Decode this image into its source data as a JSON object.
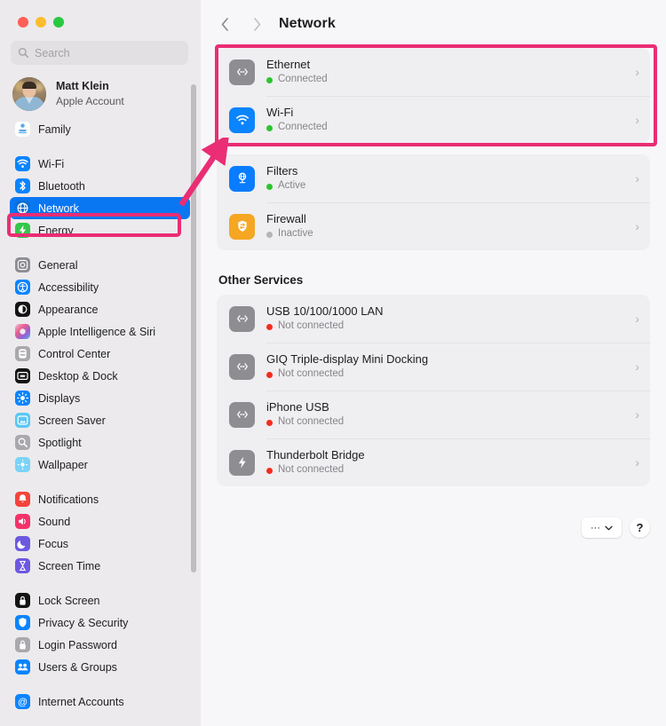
{
  "window": {
    "traffic_lights": [
      {
        "name": "close",
        "color": "#ff5f57"
      },
      {
        "name": "minimize",
        "color": "#febc2e"
      },
      {
        "name": "maximize",
        "color": "#28c840"
      }
    ]
  },
  "search": {
    "value": "",
    "placeholder": "Search"
  },
  "account": {
    "name": "Matt Klein",
    "subtitle": "Apple Account"
  },
  "sidebar": {
    "groups": [
      {
        "items": [
          {
            "label": "Family",
            "icon": "family-icon"
          }
        ]
      },
      {
        "items": [
          {
            "label": "Wi-Fi",
            "icon": "wifi-icon"
          },
          {
            "label": "Bluetooth",
            "icon": "bluetooth-icon"
          },
          {
            "label": "Network",
            "icon": "network-icon",
            "selected": true
          },
          {
            "label": "Energy",
            "icon": "energy-icon"
          }
        ]
      },
      {
        "items": [
          {
            "label": "General",
            "icon": "general-icon"
          },
          {
            "label": "Accessibility",
            "icon": "accessibility-icon"
          },
          {
            "label": "Appearance",
            "icon": "appearance-icon"
          },
          {
            "label": "Apple Intelligence & Siri",
            "icon": "apple-intelligence-icon"
          },
          {
            "label": "Control Center",
            "icon": "control-center-icon"
          },
          {
            "label": "Desktop & Dock",
            "icon": "desktop-dock-icon"
          },
          {
            "label": "Displays",
            "icon": "displays-icon"
          },
          {
            "label": "Screen Saver",
            "icon": "screen-saver-icon"
          },
          {
            "label": "Spotlight",
            "icon": "spotlight-icon"
          },
          {
            "label": "Wallpaper",
            "icon": "wallpaper-icon"
          }
        ]
      },
      {
        "items": [
          {
            "label": "Notifications",
            "icon": "notifications-icon"
          },
          {
            "label": "Sound",
            "icon": "sound-icon"
          },
          {
            "label": "Focus",
            "icon": "focus-icon"
          },
          {
            "label": "Screen Time",
            "icon": "screen-time-icon"
          }
        ]
      },
      {
        "items": [
          {
            "label": "Lock Screen",
            "icon": "lock-screen-icon"
          },
          {
            "label": "Privacy & Security",
            "icon": "privacy-security-icon"
          },
          {
            "label": "Login Password",
            "icon": "login-password-icon"
          },
          {
            "label": "Users & Groups",
            "icon": "users-groups-icon"
          }
        ]
      },
      {
        "items": [
          {
            "label": "Internet Accounts",
            "icon": "internet-accounts-icon"
          }
        ]
      }
    ]
  },
  "header": {
    "title": "Network",
    "back_icon": "chevron-left-icon",
    "forward_icon": "chevron-right-icon"
  },
  "main": {
    "primary_services": [
      {
        "title": "Ethernet",
        "status": "Connected",
        "status_color": "#2bc52f",
        "icon": "ethernet-icon",
        "icon_bg": "#8e8d92"
      },
      {
        "title": "Wi-Fi",
        "status": "Connected",
        "status_color": "#2bc52f",
        "icon": "wifi-icon",
        "icon_bg": "#0a84ff"
      }
    ],
    "security_services": [
      {
        "title": "Filters",
        "status": "Active",
        "status_color": "#2bc52f",
        "icon": "filters-icon",
        "icon_bg": "#0a7cff"
      },
      {
        "title": "Firewall",
        "status": "Inactive",
        "status_color": "#b5b4b8",
        "icon": "firewall-icon",
        "icon_bg": "#f5a623"
      }
    ],
    "other_services_heading": "Other Services",
    "other_services": [
      {
        "title": "USB 10/100/1000 LAN",
        "status": "Not connected",
        "status_color": "#f42b1f",
        "icon": "ethernet-icon",
        "icon_bg": "#8e8d92"
      },
      {
        "title": "GIQ Triple-display Mini Docking",
        "status": "Not connected",
        "status_color": "#f42b1f",
        "icon": "ethernet-icon",
        "icon_bg": "#8e8d92"
      },
      {
        "title": "iPhone USB",
        "status": "Not connected",
        "status_color": "#f42b1f",
        "icon": "ethernet-icon",
        "icon_bg": "#8e8d92"
      },
      {
        "title": "Thunderbolt Bridge",
        "status": "Not connected",
        "status_color": "#f42b1f",
        "icon": "thunderbolt-icon",
        "icon_bg": "#8e8d92"
      }
    ],
    "more_button_label": "···",
    "help_button_label": "?"
  },
  "annotations": {
    "highlight_color": "#ea2d74",
    "boxes": [
      "primary-services-card",
      "sidebar-item-network"
    ],
    "arrow": "points from Network sidebar item to primary services card"
  }
}
